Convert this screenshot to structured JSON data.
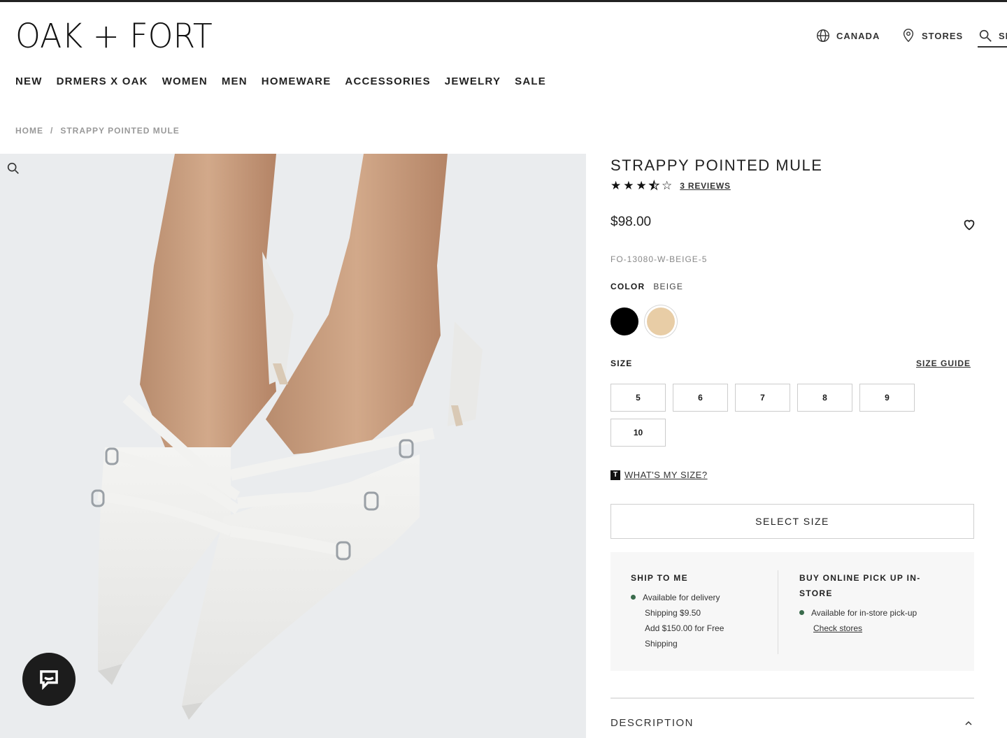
{
  "brand": {
    "logo": "OAK + FORT"
  },
  "utility": {
    "region": "CANADA",
    "stores": "STORES",
    "search": "SE"
  },
  "nav": [
    "NEW",
    "DRMERS X OAK",
    "WOMEN",
    "MEN",
    "HOMEWARE",
    "ACCESSORIES",
    "JEWELRY",
    "SALE"
  ],
  "breadcrumb": {
    "home": "HOME",
    "sep": "/",
    "current": "STRAPPY POINTED MULE"
  },
  "product": {
    "title": "STRAPPY POINTED MULE",
    "rating": 3.5,
    "reviews": "3 REVIEWS",
    "price": "$98.00",
    "sku": "FO-13080-W-BEIGE-5",
    "color_label": "COLOR",
    "color_value": "BEIGE",
    "swatches": [
      {
        "name": "black",
        "color": "#000000"
      },
      {
        "name": "beige",
        "color": "#e8cda6"
      }
    ],
    "size_label": "SIZE",
    "size_guide": "SIZE GUIDE",
    "sizes": [
      "5",
      "6",
      "7",
      "8",
      "9",
      "10"
    ],
    "whats_my_size_badge": "T",
    "whats_my_size": "WHAT'S MY SIZE?",
    "select_size": "SELECT SIZE"
  },
  "shipping": {
    "ship_title": "SHIP TO ME",
    "ship_lines": [
      "Available for delivery",
      "Shipping $9.50",
      "Add $150.00 for Free",
      "Shipping"
    ],
    "pickup_title_1": "BUY ONLINE PICK UP IN-",
    "pickup_title_2": "STORE",
    "pickup_line": "Available for in-store pick-up",
    "check_stores": "Check stores"
  },
  "description": {
    "label": "DESCRIPTION"
  }
}
